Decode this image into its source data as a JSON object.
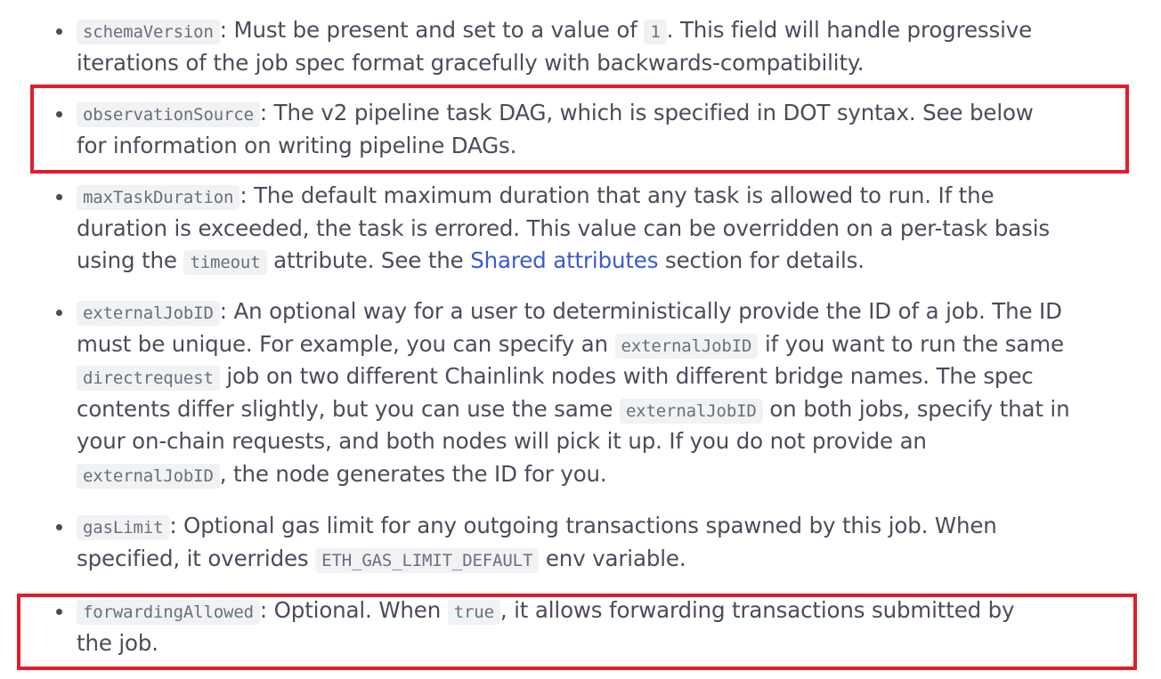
{
  "items": [
    {
      "code": "schemaVersion",
      "l1_a": ": Must be present and set to a value of ",
      "l1_code": "1",
      "l1_b": ". This field will handle progressive",
      "l2": "iterations of the job spec format gracefully with backwards-compatibility."
    },
    {
      "code": "observationSource",
      "l1": ": The v2 pipeline task DAG, which is specified in DOT syntax. See below",
      "l2": "for information on writing pipeline DAGs."
    },
    {
      "code": "maxTaskDuration",
      "l1": ": The default maximum duration that any task is allowed to run. If the",
      "l2": "duration is exceeded, the task is errored. This value can be overridden on a per-task basis",
      "l3_a": "using the ",
      "l3_code": "timeout",
      "l3_b": " attribute. See the ",
      "l3_link": "Shared attributes",
      "l3_c": " section for details."
    },
    {
      "code": "externalJobID",
      "l1": ": An optional way for a user to deterministically provide the ID of a job. The ID",
      "l2_a": "must be unique. For example, you can specify an ",
      "l2_code": "externalJobID",
      "l2_b": " if you want to run the same",
      "l3_code": "directrequest",
      "l3_a": " job on two different Chainlink nodes with different bridge names. The spec",
      "l4_a": "contents differ slightly, but you can use the same ",
      "l4_code": "externalJobID",
      "l4_b": " on both jobs, specify that in",
      "l5": "your on-chain requests, and both nodes will pick it up. If you do not provide an",
      "l6_code": "externalJobID",
      "l6_a": ", the node generates the ID for you."
    },
    {
      "code": "gasLimit",
      "l1": ": Optional gas limit for any outgoing transactions spawned by this job. When",
      "l2_a": "specified, it overrides ",
      "l2_code": "ETH_GAS_LIMIT_DEFAULT",
      "l2_b": " env variable."
    },
    {
      "code": "forwardingAllowed",
      "l1_a": ": Optional. When ",
      "l1_code": "true",
      "l1_b": ", it allows forwarding transactions submitted by",
      "l2": "the job."
    }
  ],
  "colors": {
    "text": "#4a4c5a",
    "link": "#375bd2",
    "highlight_border": "#e11d2b",
    "code_background": "#f1f2f4"
  }
}
